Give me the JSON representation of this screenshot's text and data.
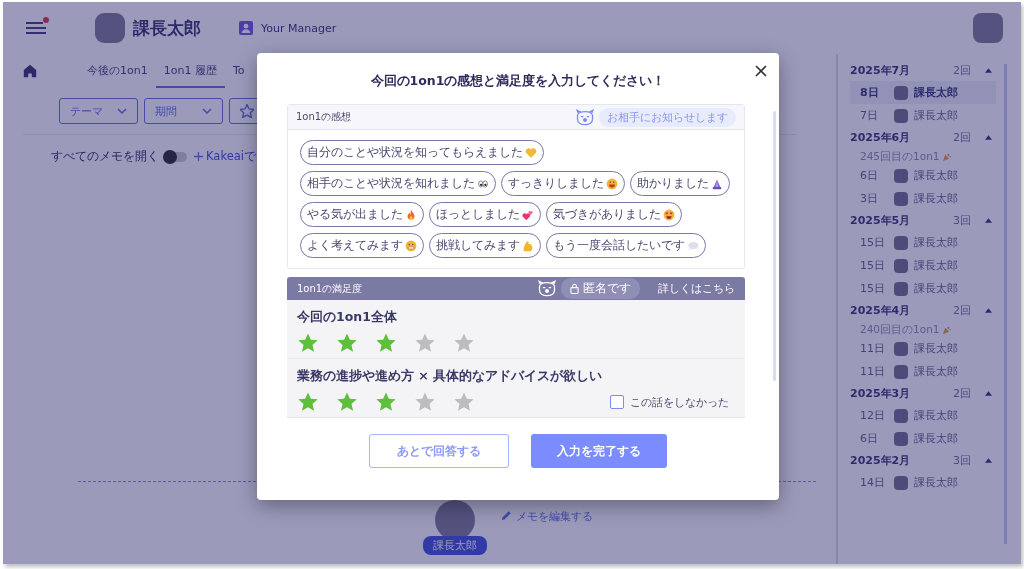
{
  "header": {
    "user_name": "課長太郎",
    "role_badge": "Your Manager",
    "notification": true
  },
  "tabs": [
    {
      "label": "今後の1on1",
      "selected": false
    },
    {
      "label": "1on1 履歴",
      "selected": true
    },
    {
      "label": "To",
      "selected": false
    }
  ],
  "filters": [
    {
      "kind": "dropdown",
      "label": "テーマ"
    },
    {
      "kind": "dropdown",
      "label": "期間"
    },
    {
      "kind": "star"
    }
  ],
  "memo_toggle": {
    "label": "すべてのメモを開く",
    "on": false
  },
  "add_link": "Kakeaiで",
  "history": [
    {
      "month": "2025年7月",
      "count": "2回",
      "expanded": true,
      "entries": [
        {
          "day": "8日",
          "name": "課長太郎",
          "selected": true
        },
        {
          "day": "7日",
          "name": "課長太郎",
          "selected": false
        }
      ]
    },
    {
      "month": "2025年6月",
      "count": "2回",
      "expanded": true,
      "entries": [
        {
          "note": "245回目の1on1",
          "day": "6日",
          "name": "課長太郎",
          "selected": false
        },
        {
          "day": "3日",
          "name": "課長太郎",
          "selected": false
        }
      ]
    },
    {
      "month": "2025年5月",
      "count": "3回",
      "expanded": true,
      "entries": [
        {
          "day": "15日",
          "name": "課長太郎",
          "selected": false
        },
        {
          "day": "15日",
          "name": "課長太郎",
          "selected": false
        },
        {
          "day": "15日",
          "name": "課長太郎",
          "selected": false
        }
      ]
    },
    {
      "month": "2025年4月",
      "count": "2回",
      "expanded": true,
      "entries": [
        {
          "note": "240回目の1on1",
          "day": "11日",
          "name": "課長太郎",
          "selected": false
        },
        {
          "day": "11日",
          "name": "課長太郎",
          "selected": false
        }
      ]
    },
    {
      "month": "2025年3月",
      "count": "2回",
      "expanded": true,
      "entries": [
        {
          "day": "12日",
          "name": "課長太郎",
          "selected": false
        },
        {
          "day": "6日",
          "name": "課長太郎",
          "selected": false
        }
      ]
    },
    {
      "month": "2025年2月",
      "count": "3回",
      "expanded": true,
      "entries": [
        {
          "day": "14日",
          "name": "課長太郎",
          "selected": false
        }
      ]
    }
  ],
  "memo_footer": {
    "name": "課長太郎",
    "edit_link": "メモを編集する"
  },
  "modal": {
    "title": "今回の1on1の感想と満足度を入力してください！",
    "feedback": {
      "heading": "1on1の感想",
      "notice": "お相手にお知らせします",
      "chips": [
        {
          "label": "自分のことや状況を知ってもらえました",
          "kind": "heart",
          "selected": false
        },
        {
          "label": "相手のことや状況を知れました",
          "kind": "eyes",
          "selected": false
        },
        {
          "label": "すっきりしました",
          "kind": "grin",
          "selected": false
        },
        {
          "label": "助かりました",
          "kind": "pray",
          "selected": false
        },
        {
          "label": "やる気が出ました",
          "kind": "fire",
          "selected": false
        },
        {
          "label": "ほっとしました",
          "kind": "hearts",
          "selected": false
        },
        {
          "label": "気づきがありました",
          "kind": "heart-eyes",
          "selected": false
        },
        {
          "label": "よく考えてみます",
          "kind": "grimace",
          "selected": false
        },
        {
          "label": "挑戦してみます",
          "kind": "muscle",
          "selected": false
        },
        {
          "label": "もう一度会話したいです",
          "kind": "speech",
          "selected": false
        }
      ]
    },
    "satisfaction": {
      "heading": "1on1の満足度",
      "anonymous": "匿名です",
      "details_link": "詳しくはこちら",
      "questions": [
        {
          "label": "今回の1on1全体",
          "stars": 3
        },
        {
          "label": "業務の進捗や進め方 × 具体的なアドバイスが欲しい",
          "stars": 3,
          "skip_option": {
            "label": "この話をしなかった",
            "checked": false
          }
        }
      ]
    },
    "buttons": [
      {
        "label": "あとで回答する",
        "kind": "secondary"
      },
      {
        "label": "入力を完了する",
        "kind": "primary"
      }
    ]
  }
}
